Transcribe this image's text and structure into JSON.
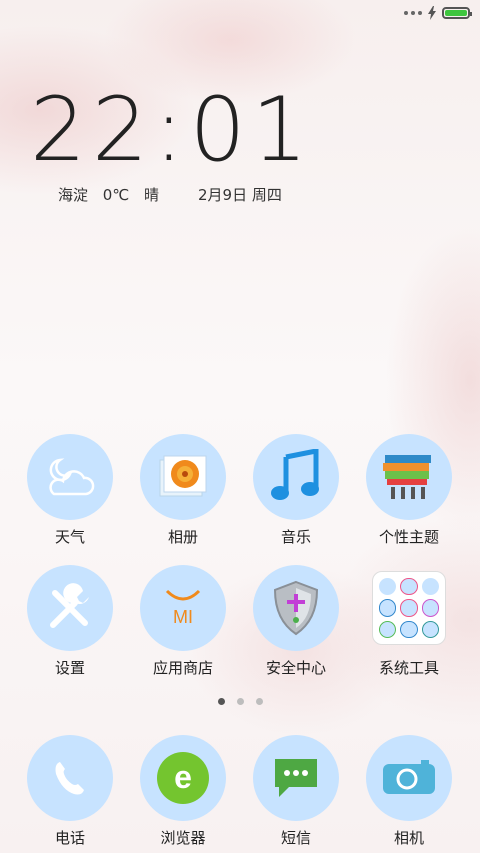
{
  "status_bar": {
    "battery_level": 1.0,
    "icons": [
      "more-dots-icon",
      "charging-bolt-icon",
      "battery-icon"
    ]
  },
  "lockscreen": {
    "time": "22:01",
    "location": "海淀",
    "temperature": "0℃",
    "condition": "晴",
    "date": "2月9日 周四"
  },
  "apps_row1": [
    {
      "label": "天气",
      "icon": "weather-icon"
    },
    {
      "label": "相册",
      "icon": "gallery-icon"
    },
    {
      "label": "音乐",
      "icon": "music-icon"
    },
    {
      "label": "个性主题",
      "icon": "themes-icon"
    }
  ],
  "apps_row2": [
    {
      "label": "设置",
      "icon": "settings-icon"
    },
    {
      "label": "应用商店",
      "icon": "app-store-icon"
    },
    {
      "label": "安全中心",
      "icon": "security-icon"
    },
    {
      "label": "系统工具",
      "icon": "system-tools-folder-icon"
    }
  ],
  "dock": [
    {
      "label": "电话",
      "icon": "phone-icon"
    },
    {
      "label": "浏览器",
      "icon": "browser-icon"
    },
    {
      "label": "短信",
      "icon": "messages-icon"
    },
    {
      "label": "相机",
      "icon": "camera-icon"
    }
  ],
  "store_logo_text": "MI",
  "page_indicator": {
    "count": 3,
    "active": 1
  },
  "colors": {
    "icon_bg": "#c7e3ff",
    "battery": "#3ec53e"
  }
}
